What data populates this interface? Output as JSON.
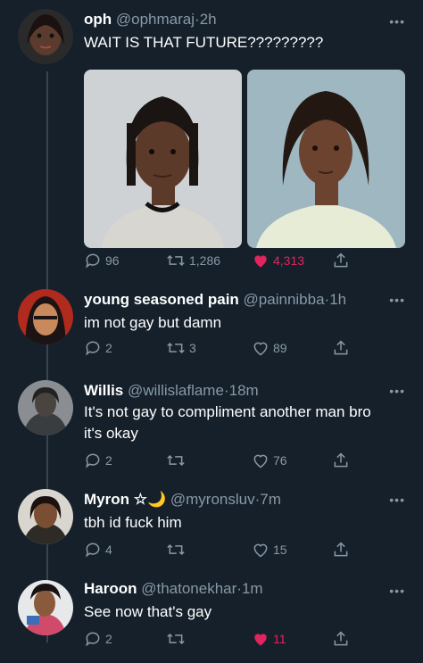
{
  "tweets": [
    {
      "name": "oph",
      "handle": "@ophmaraj",
      "sep": "·",
      "time": "2h",
      "text": "WAIT IS THAT FUTURE?????????",
      "replies": "96",
      "retweets": "1,286",
      "likes": "4,313",
      "liked": true
    },
    {
      "name": "young seasoned pain",
      "handle": "@painnibba",
      "sep": "·",
      "time": "1h",
      "text": "im not gay but damn",
      "replies": "2",
      "retweets": "3",
      "likes": "89",
      "liked": false
    },
    {
      "name": "Willis",
      "handle": "@willislaflame",
      "sep": "·",
      "time": "18m",
      "text": "It's not gay to compliment another man bro it's okay",
      "replies": "2",
      "retweets": "",
      "likes": "76",
      "liked": false
    },
    {
      "name": "Myron ☆🌙",
      "handle": "@myronsluv",
      "sep": "·",
      "time": "7m",
      "text": "tbh id fuck him",
      "replies": "4",
      "retweets": "",
      "likes": "15",
      "liked": false
    },
    {
      "name": "Haroon",
      "handle": "@thatonekhar",
      "sep": "·",
      "time": "1m",
      "text": "See now that's gay",
      "replies": "2",
      "retweets": "",
      "likes": "11",
      "liked": true
    }
  ],
  "icons": {
    "reply": "reply-icon",
    "retweet": "retweet-icon",
    "like": "heart-icon",
    "share": "share-icon",
    "more": "more-icon"
  },
  "colors": {
    "background": "#15202b",
    "muted": "#8899a6",
    "like": "#e0245e"
  }
}
